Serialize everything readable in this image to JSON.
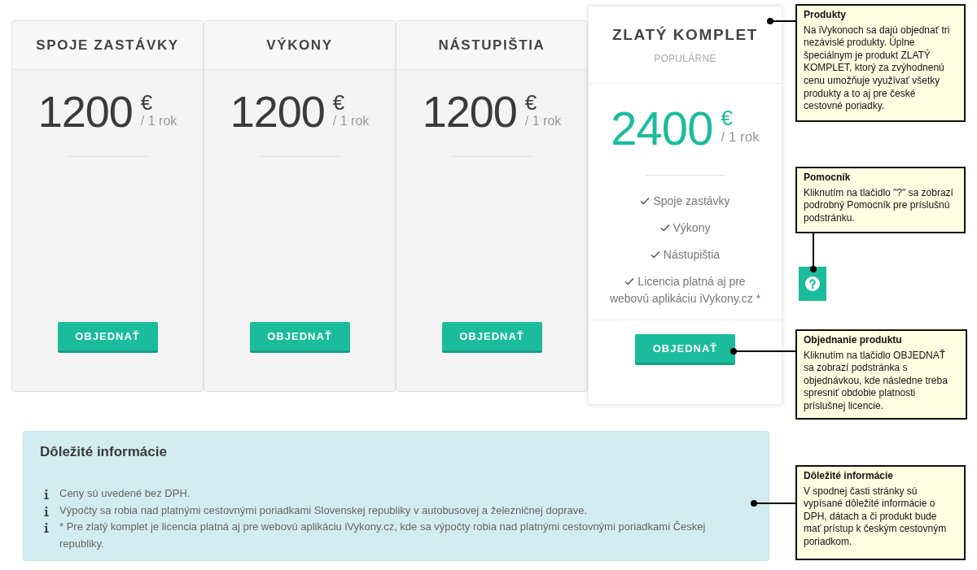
{
  "plans": [
    {
      "kind": "standard",
      "title": "SPOJE ZASTÁVKY",
      "price": "1200",
      "currency": "€",
      "period": "/ 1 rok",
      "button": "OBJEDNAŤ"
    },
    {
      "kind": "standard",
      "title": "VÝKONY",
      "price": "1200",
      "currency": "€",
      "period": "/ 1 rok",
      "button": "OBJEDNAŤ"
    },
    {
      "kind": "standard",
      "title": "NÁSTUPIŠTIA",
      "price": "1200",
      "currency": "€",
      "period": "/ 1 rok",
      "button": "OBJEDNAŤ"
    },
    {
      "kind": "featured",
      "title": "ZLATÝ KOMPLET",
      "subtitle": "POPULÁRNE",
      "price": "2400",
      "currency": "€",
      "period": "/ 1 rok",
      "features": [
        "Spoje zastávky",
        "Výkony",
        "Nástupištia",
        "Licencia platná aj pre webovú aplikáciu iVykony.cz *"
      ],
      "button": "OBJEDNAŤ"
    }
  ],
  "info": {
    "title": "Dôležité informácie",
    "items": [
      "Ceny sú uvedené bez DPH.",
      "Výpočty sa robia nad platnými cestovnými poriadkami Slovenskej republiky v autobusovej a železničnej doprave.",
      "* Pre zlatý komplet je licencia platná aj pre webovú aplikáciu iVykony.cz, kde sa výpočty robia nad platnými cestovnými poriadkami Českej republiky."
    ]
  },
  "callouts": [
    {
      "title": "Produkty",
      "text": "Na iVykonoch sa dajú objednať tri nezávislé produkty. Úplne špeciálnym je produkt ZLATÝ KOMPLET, ktorý za zvýhodnenú cenu umožňuje využívať všetky produkty a to aj pre české cestovné poriadky."
    },
    {
      "title": "Pomocník",
      "text": "Kliknutím na tlačidlo \"?\" sa zobrazí podrobný Pomocník pre príslušnú podstránku."
    },
    {
      "title": "Objednanie produktu",
      "text": "Kliknutím na tlačidlo OBJEDNAŤ sa zobrazí podstránka s objednávkou, kde následne treba spresniť obdobie platnosti príslušnej licencie."
    },
    {
      "title": "Dôležité informácie",
      "text": "V spodnej časti stránky sú vypísané dôležité informácie o DPH, dátach a či produkt bude mať prístup k českým cestovným poriadkom."
    }
  ]
}
